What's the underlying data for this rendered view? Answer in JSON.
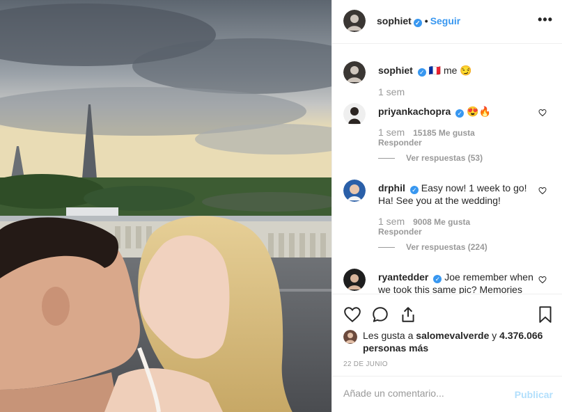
{
  "header": {
    "username": "sophiet",
    "verified_icon": "verified-badge-icon",
    "separator": "•",
    "follow_label": "Seguir",
    "more_icon": "•••"
  },
  "caption": {
    "username": "sophiet",
    "text": "🇫🇷 me 😏",
    "time": "1 sem"
  },
  "comments": [
    {
      "username": "priyankachopra",
      "text": "😍🔥",
      "time": "1 sem",
      "likes": "15185 Me gusta",
      "reply_label": "Responder",
      "view_replies": "Ver respuestas (53)"
    },
    {
      "username": "drphil",
      "text": "Easy now! 1 week to go! Ha! See you at the wedding!",
      "time": "1 sem",
      "likes": "9008 Me gusta",
      "reply_label": "Responder",
      "view_replies": "Ver respuestas (224)"
    },
    {
      "username": "ryantedder",
      "text": "Joe remember when we took this same pic? Memories"
    }
  ],
  "likes": {
    "prefix": "Les gusta a",
    "first_user": "salomevalverde",
    "joiner": "y",
    "others": "4.376.066 personas más"
  },
  "date": "22 DE JUNIO",
  "add_comment": {
    "placeholder": "Añade un comentario...",
    "publish_label": "Publicar"
  },
  "colors": {
    "accent": "#3897f0",
    "publish_disabled": "#b2dffc",
    "muted": "#999999",
    "text": "#262626"
  }
}
